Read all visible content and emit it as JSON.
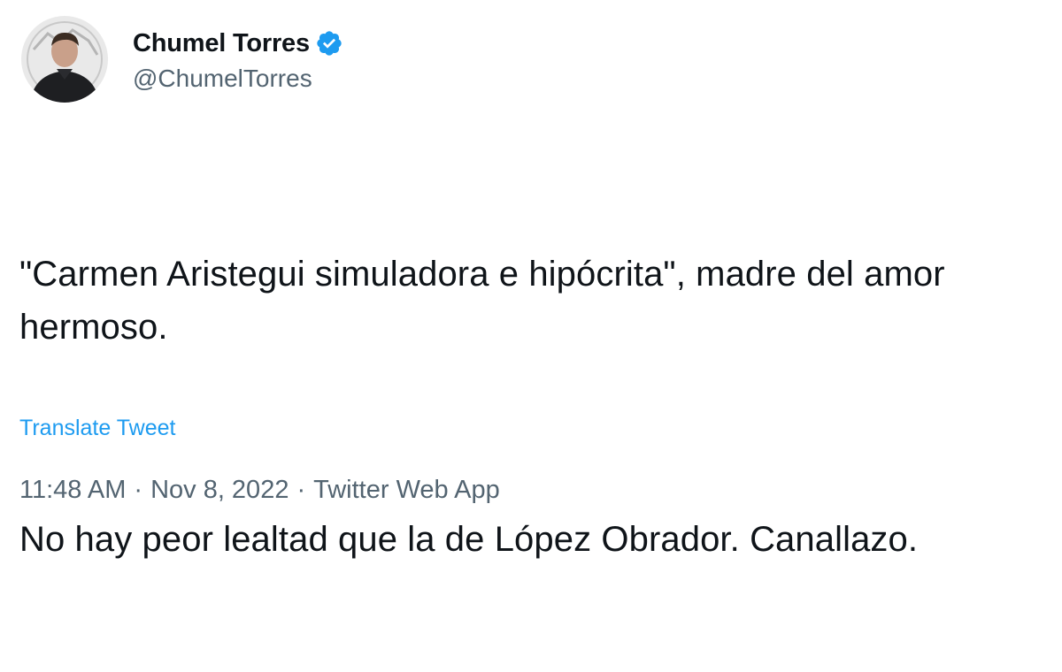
{
  "author": {
    "display_name": "Chumel Torres",
    "handle": "@ChumelTorres",
    "verified_icon": "verified-badge-icon",
    "avatar_icon": "user-avatar"
  },
  "tweet": {
    "paragraph_1": "\"Carmen Aristegui simuladora e hipócrita\", madre del amor hermoso.",
    "paragraph_2": "No hay peor lealtad que la de López Obrador. Canallazo.",
    "translate_label": "Translate Tweet"
  },
  "meta": {
    "time": "11:48 AM",
    "date": "Nov 8, 2022",
    "source": "Twitter Web App",
    "separator": "·"
  },
  "colors": {
    "text": "#0f1419",
    "secondary": "#536471",
    "link": "#1d9bf0",
    "verified": "#1d9bf0"
  }
}
